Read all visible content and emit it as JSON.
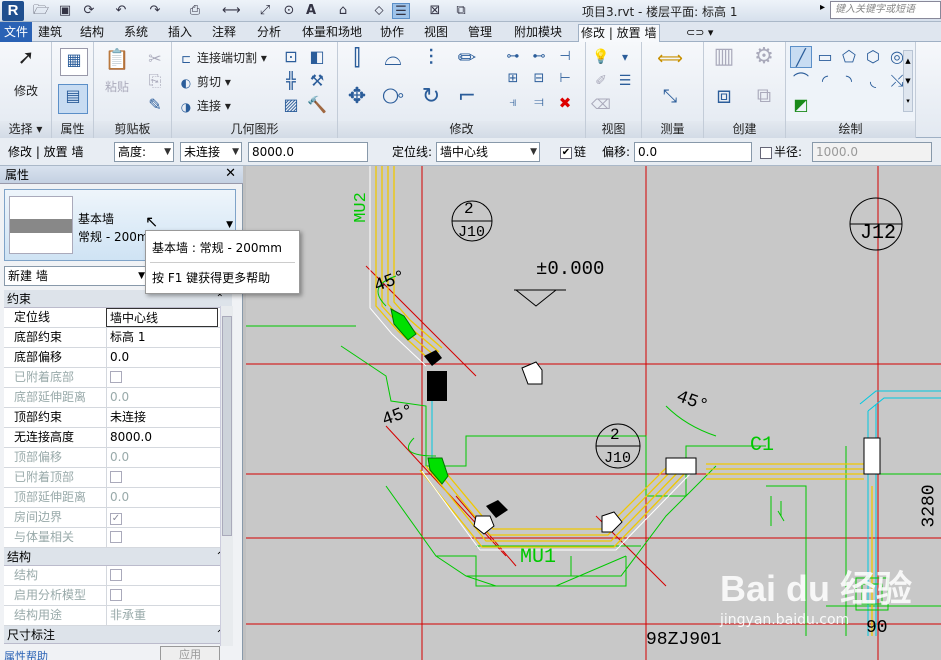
{
  "app": {
    "logo": "R",
    "doc_title": "项目3.rvt - 楼层平面: 标高 1",
    "search_placeholder": "键入关键字或短语"
  },
  "quick_access": {
    "icons": [
      "open-icon",
      "save-icon",
      "sync-icon",
      "undo-icon",
      "redo-icon",
      "print-icon",
      "measure-icon",
      "dimension-icon",
      "tag-icon",
      "text-icon",
      "3d-view-icon",
      "section-icon",
      "thin-lines-icon",
      "close-hidden-icon",
      "switch-window-icon"
    ]
  },
  "tabs": [
    "文件",
    "建筑",
    "结构",
    "系统",
    "插入",
    "注释",
    "分析",
    "体量和场地",
    "协作",
    "视图",
    "管理",
    "附加模块",
    "修改 | 放置 墙"
  ],
  "active_tab": "修改 | 放置 墙",
  "ribbon": {
    "select": {
      "button": "修改",
      "label": "选择"
    },
    "properties": {
      "label": "属性"
    },
    "clipboard": {
      "paste": "粘贴",
      "label": "剪贴板"
    },
    "geometry": {
      "items": [
        "连接端切割",
        "剪切",
        "连接"
      ],
      "label": "几何图形"
    },
    "modify": {
      "label": "修改"
    },
    "view": {
      "label": "视图"
    },
    "measure": {
      "label": "测量"
    },
    "create": {
      "label": "创建"
    },
    "draw": {
      "label": "绘制"
    }
  },
  "options_bar": {
    "context": "修改 | 放置 墙",
    "height_mode": "高度:",
    "top_constraint": "未连接",
    "height_value": "8000.0",
    "location_line_label": "定位线:",
    "location_line": "墙中心线",
    "chain_label": "链",
    "chain_checked": true,
    "offset_label": "偏移:",
    "offset_value": "0.0",
    "radius_label": "半径:",
    "radius_checked": false,
    "radius_value": "1000.0"
  },
  "properties": {
    "title": "属性",
    "type_family": "基本墙",
    "type_name": "常规 - 200mm",
    "tooltip_title": "基本墙 : 常规 - 200mm",
    "tooltip_help": "按 F1 键获得更多帮助",
    "instance_selector": "新建 墙",
    "groups": [
      {
        "name": "约束",
        "rows": [
          {
            "k": "定位线",
            "v": "墙中心线",
            "dis": false,
            "edit": true
          },
          {
            "k": "底部约束",
            "v": "标高 1",
            "dis": false
          },
          {
            "k": "底部偏移",
            "v": "0.0",
            "dis": false
          },
          {
            "k": "已附着底部",
            "v": "",
            "dis": true,
            "check": true
          },
          {
            "k": "底部延伸距离",
            "v": "0.0",
            "dis": true
          },
          {
            "k": "顶部约束",
            "v": "未连接",
            "dis": false
          },
          {
            "k": "无连接高度",
            "v": "8000.0",
            "dis": false
          },
          {
            "k": "顶部偏移",
            "v": "0.0",
            "dis": true
          },
          {
            "k": "已附着顶部",
            "v": "",
            "dis": true,
            "check": true
          },
          {
            "k": "顶部延伸距离",
            "v": "0.0",
            "dis": true
          },
          {
            "k": "房间边界",
            "v": "",
            "dis": true,
            "check": true,
            "checked": true
          },
          {
            "k": "与体量相关",
            "v": "",
            "dis": true,
            "check": true
          }
        ]
      },
      {
        "name": "结构",
        "rows": [
          {
            "k": "结构",
            "v": "",
            "dis": true,
            "check": true
          },
          {
            "k": "启用分析模型",
            "v": "",
            "dis": true,
            "check": true
          },
          {
            "k": "结构用途",
            "v": "非承重",
            "dis": true
          }
        ]
      },
      {
        "name": "尺寸标注",
        "rows": []
      }
    ],
    "help_link": "属性帮助",
    "apply": "应用"
  },
  "canvas": {
    "labels": {
      "mu2": "MU2",
      "mu1": "MU1",
      "c1": "C1",
      "j12": "J12",
      "grid_2a": "2",
      "grid_j10a": "J10",
      "grid_2b": "2",
      "grid_j10b": "J10",
      "elev": "±0.000",
      "angle_a": "45°",
      "angle_b": "45°",
      "angle_c": "45°",
      "dim_3280": "3280",
      "ref_98zj": "98ZJ901",
      "num_90": "90"
    }
  },
  "watermark": {
    "text": "Bai du 经验",
    "url": "jingyan.baidu.com"
  },
  "colors": {
    "accent": "#2a62b5",
    "wall": "#ffd700",
    "grid_red": "#d40000",
    "green": "#00c800"
  }
}
